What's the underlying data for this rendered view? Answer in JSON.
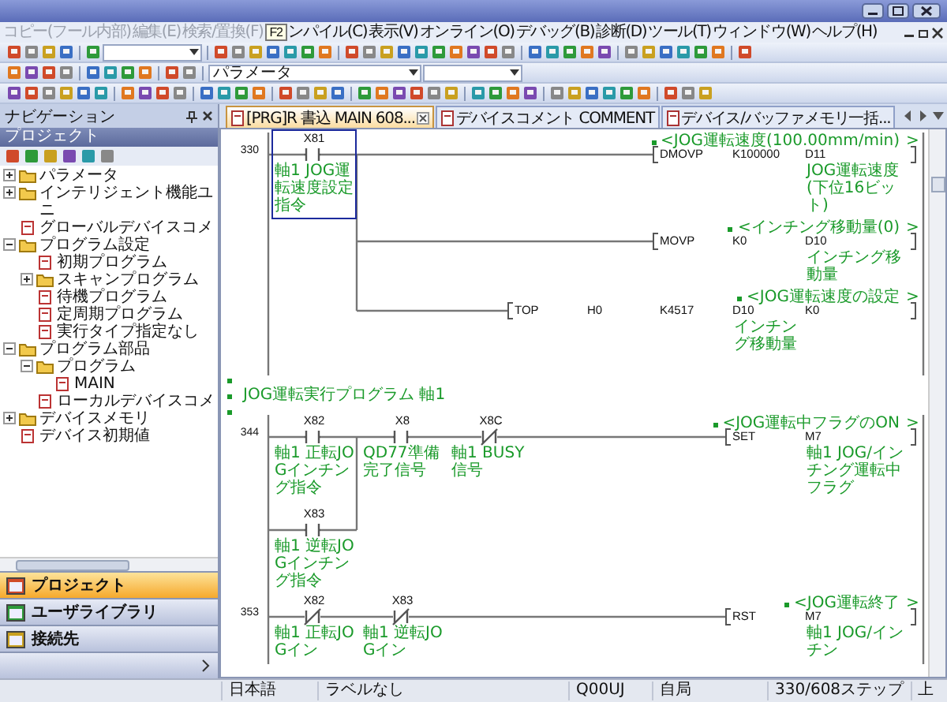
{
  "window": {
    "menu": [
      {
        "label": "コピー(フール内部)",
        "disabled": true
      },
      {
        "label": "編集(E)",
        "disabled": true
      },
      {
        "label": "検索/置換(F)",
        "disabled": true
      },
      {
        "label": "ンパイル(C)",
        "disabled": false
      },
      {
        "label": "表示(V)",
        "disabled": false
      },
      {
        "label": "オンライン(O)",
        "disabled": false
      },
      {
        "label": "デバッグ(B)",
        "disabled": false
      },
      {
        "label": "診断(D)",
        "disabled": false
      },
      {
        "label": "ツール(T)",
        "disabled": false
      },
      {
        "label": "ウィンドウ(W)",
        "disabled": false
      },
      {
        "label": "ヘルプ(H)",
        "disabled": false
      }
    ],
    "tooltip": "F2"
  },
  "toolbar": {
    "program_dropdown": "パラメータ"
  },
  "navigation": {
    "title": "ナビゲーション",
    "section": "プロジェクト",
    "tree": [
      {
        "label": "パラメータ",
        "expanded": false
      },
      {
        "label": "インテリジェント機能ユニ",
        "expanded": false
      },
      {
        "label": "グローバルデバイスコメ"
      },
      {
        "label": "プログラム設定",
        "expanded": true,
        "children": [
          {
            "label": "初期プログラム"
          },
          {
            "label": "スキャンプログラム",
            "expanded": false
          },
          {
            "label": "待機プログラム"
          },
          {
            "label": "定周期プログラム"
          },
          {
            "label": "実行タイプ指定なし"
          }
        ]
      },
      {
        "label": "プログラム部品",
        "expanded": true,
        "children": [
          {
            "label": "プログラム",
            "expanded": true,
            "children": [
              {
                "label": "MAIN"
              }
            ]
          },
          {
            "label": "ローカルデバイスコメ"
          }
        ]
      },
      {
        "label": "デバイスメモリ",
        "expanded": false
      },
      {
        "label": "デバイス初期値"
      }
    ],
    "buttons": [
      {
        "label": "プロジェクト",
        "selected": true
      },
      {
        "label": "ユーザライブラリ",
        "selected": false
      },
      {
        "label": "接続先",
        "selected": false
      }
    ]
  },
  "tabs": [
    {
      "label": "[PRG]R 書込 MAIN 608...",
      "selected": true
    },
    {
      "label": "デバイスコメント COMMENT",
      "selected": false
    },
    {
      "label": "デバイス/バッファメモリ一括...",
      "selected": false
    }
  ],
  "ladder": {
    "blocks": [
      {
        "kind": "rung",
        "step": "330",
        "contacts": [
          {
            "device": "X81",
            "comment": "軸1 JOG運転速度設定指令",
            "kind": "no",
            "selected": true
          }
        ],
        "outputs": [
          {
            "note": "<JOG運転速度(100.00mm/min)",
            "note_end": ">",
            "instruction": "DMOVP",
            "operands": [
              {
                "device": "K100000"
              },
              {
                "device": "D11",
                "comment": "JOG運転速度(下位16ビット)"
              }
            ]
          },
          {
            "note": "<インチング移動量(0)",
            "note_end": ">",
            "instruction": "MOVP",
            "operands": [
              {
                "device": "K0"
              },
              {
                "device": "D10",
                "comment": "インチング移動量"
              }
            ]
          },
          {
            "note": "<JOG運転速度の設定",
            "note_end": ">",
            "instruction": "TOP",
            "operands": [
              {
                "device": "H0"
              },
              {
                "device": "K4517"
              },
              {
                "device": "D10",
                "comment": "インチング移動量"
              },
              {
                "device": "K0"
              }
            ]
          }
        ]
      },
      {
        "kind": "statement",
        "text": "JOG運転実行プログラム 軸1"
      },
      {
        "kind": "rung",
        "step": "344",
        "contacts": [
          {
            "device": "X82",
            "comment": "軸1 正転JOGインチング指令",
            "kind": "no",
            "selected": false
          },
          {
            "device": "X8",
            "comment": "QD77準備完了信号",
            "kind": "no",
            "selected": false
          },
          {
            "device": "X8C",
            "comment": "軸1 BUSY信号",
            "kind": "nc",
            "selected": false
          }
        ],
        "branch": [
          {
            "device": "X83",
            "comment": "軸1 逆転JOGインチング指令",
            "kind": "no",
            "selected": false
          }
        ],
        "outputs": [
          {
            "note": "<JOG運転中フラグのON",
            "note_end": ">",
            "instruction": "SET",
            "operands": [
              {
                "device": "M7",
                "comment": "軸1 JOG/インチング運転中フラグ"
              }
            ]
          }
        ]
      },
      {
        "kind": "rung",
        "step": "353",
        "contacts": [
          {
            "device": "X82",
            "comment": "軸1 正転JOGイン",
            "kind": "nc",
            "selected": false
          },
          {
            "device": "X83",
            "comment": "軸1 逆転JOGイン",
            "kind": "nc",
            "selected": false
          }
        ],
        "outputs": [
          {
            "note": "<JOG運転終了",
            "note_end": ">",
            "instruction": "RST",
            "operands": [
              {
                "device": "M7",
                "comment": "軸1 JOG/インチン"
              }
            ]
          }
        ]
      }
    ]
  },
  "status_bar": [
    "日本語",
    "ラベルなし",
    "Q00UJ",
    "自局",
    "330/608ステップ",
    "上"
  ]
}
